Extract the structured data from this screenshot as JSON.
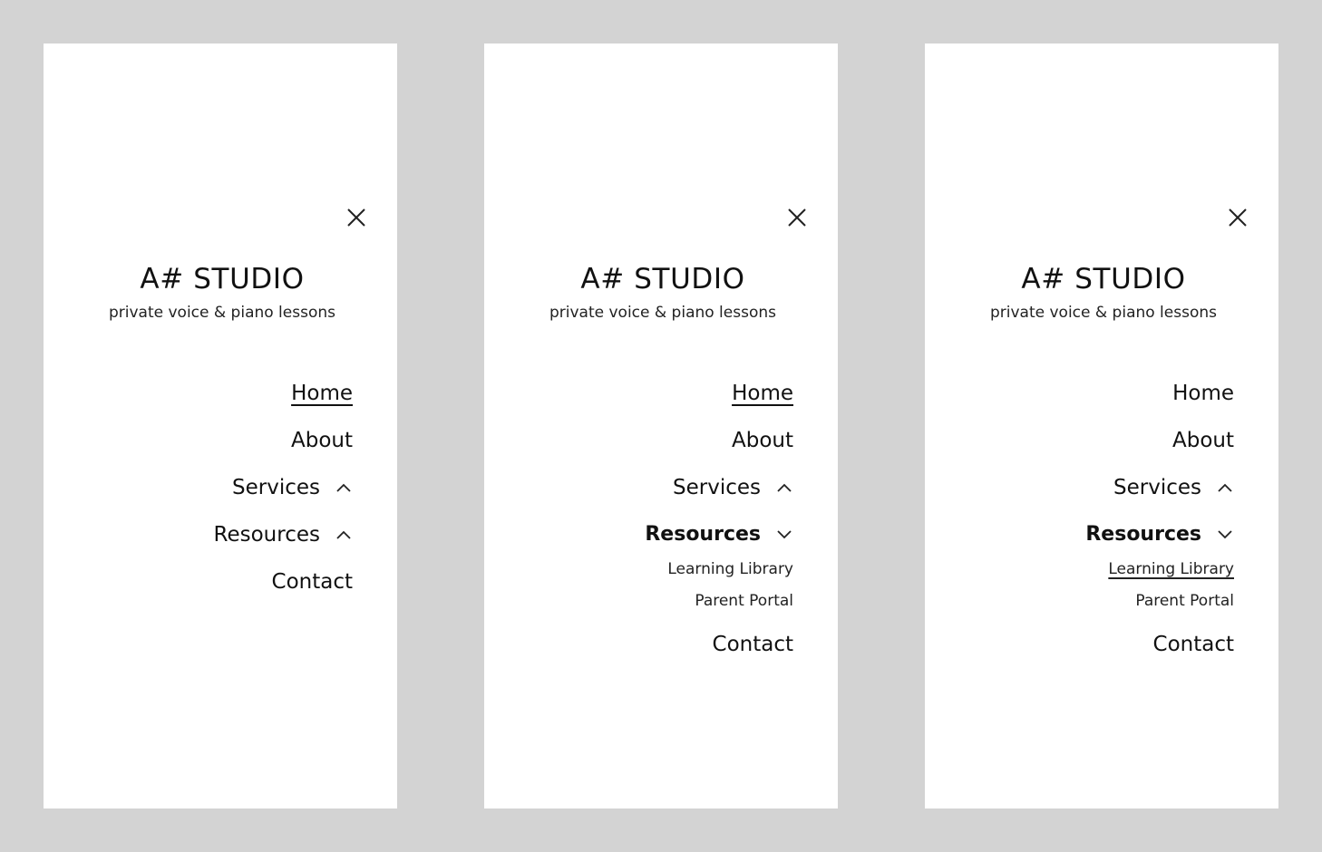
{
  "brand": {
    "title": "A# STUDIO",
    "tagline": "private voice & piano lessons"
  },
  "panels": [
    {
      "nav": {
        "home": "Home",
        "about": "About",
        "services": "Services",
        "resources": "Resources",
        "contact": "Contact"
      },
      "active": "Home",
      "services_chevron": "chevron-up-icon",
      "resources_chevron": "chevron-up-icon"
    },
    {
      "nav": {
        "home": "Home",
        "about": "About",
        "services": "Services",
        "resources": "Resources",
        "resources_sub": [
          "Learning Library",
          "Parent Portal"
        ],
        "contact": "Contact"
      },
      "active": "Home",
      "services_chevron": "chevron-up-icon",
      "resources_chevron": "chevron-down-icon"
    },
    {
      "nav": {
        "home": "Home",
        "about": "About",
        "services": "Services",
        "resources": "Resources",
        "resources_sub": [
          "Learning Library",
          "Parent Portal"
        ],
        "contact": "Contact"
      },
      "active": "Learning Library",
      "services_chevron": "chevron-up-icon",
      "resources_chevron": "chevron-down-icon"
    }
  ],
  "colors": {
    "background": "#d3d3d3",
    "panel": "#ffffff",
    "text": "#111111"
  }
}
